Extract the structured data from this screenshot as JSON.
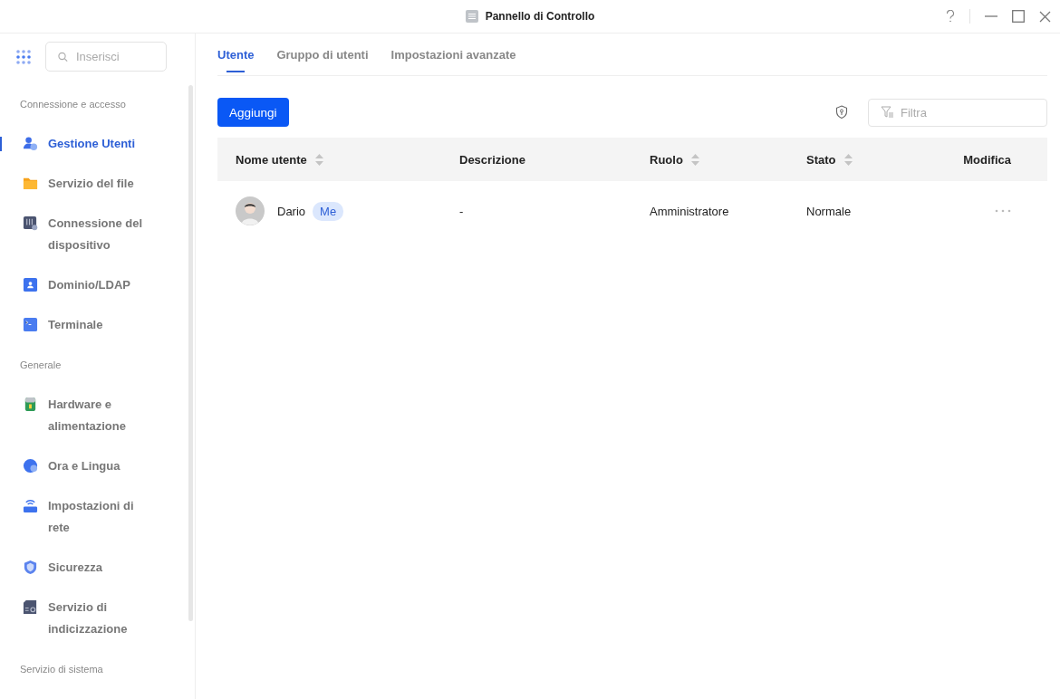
{
  "window": {
    "title": "Pannello di Controllo"
  },
  "sidebar": {
    "search": {
      "placeholder": "Inserisci"
    },
    "sections": [
      {
        "label": "Connessione e accesso",
        "items": [
          {
            "label": "Gestione Utenti",
            "selected": true
          },
          {
            "label": "Servizio del file",
            "selected": false
          },
          {
            "label": "Connessione del dispositivo",
            "selected": false
          },
          {
            "label": "Dominio/LDAP",
            "selected": false
          },
          {
            "label": "Terminale",
            "selected": false
          }
        ]
      },
      {
        "label": "Generale",
        "items": [
          {
            "label": "Hardware e alimentazione",
            "selected": false
          },
          {
            "label": "Ora e Lingua",
            "selected": false
          },
          {
            "label": "Impostazioni di rete",
            "selected": false
          },
          {
            "label": "Sicurezza",
            "selected": false
          },
          {
            "label": "Servizio di indicizzazione",
            "selected": false
          }
        ]
      },
      {
        "label": "Servizio di sistema"
      }
    ]
  },
  "tabs": [
    {
      "label": "Utente",
      "selected": true
    },
    {
      "label": "Gruppo di utenti",
      "selected": false
    },
    {
      "label": "Impostazioni avanzate",
      "selected": false
    }
  ],
  "toolbar": {
    "add_button": "Aggiungi",
    "filter": {
      "placeholder": "Filtra"
    }
  },
  "table": {
    "columns": [
      {
        "label": "Nome utente",
        "sortable": true
      },
      {
        "label": "Descrizione",
        "sortable": false
      },
      {
        "label": "Ruolo",
        "sortable": true
      },
      {
        "label": "Stato",
        "sortable": true
      },
      {
        "label": "Modifica",
        "sortable": false
      }
    ],
    "rows": [
      {
        "name": "Dario",
        "badge": "Me",
        "description": "-",
        "role": "Amministratore",
        "status": "Normale"
      }
    ]
  }
}
